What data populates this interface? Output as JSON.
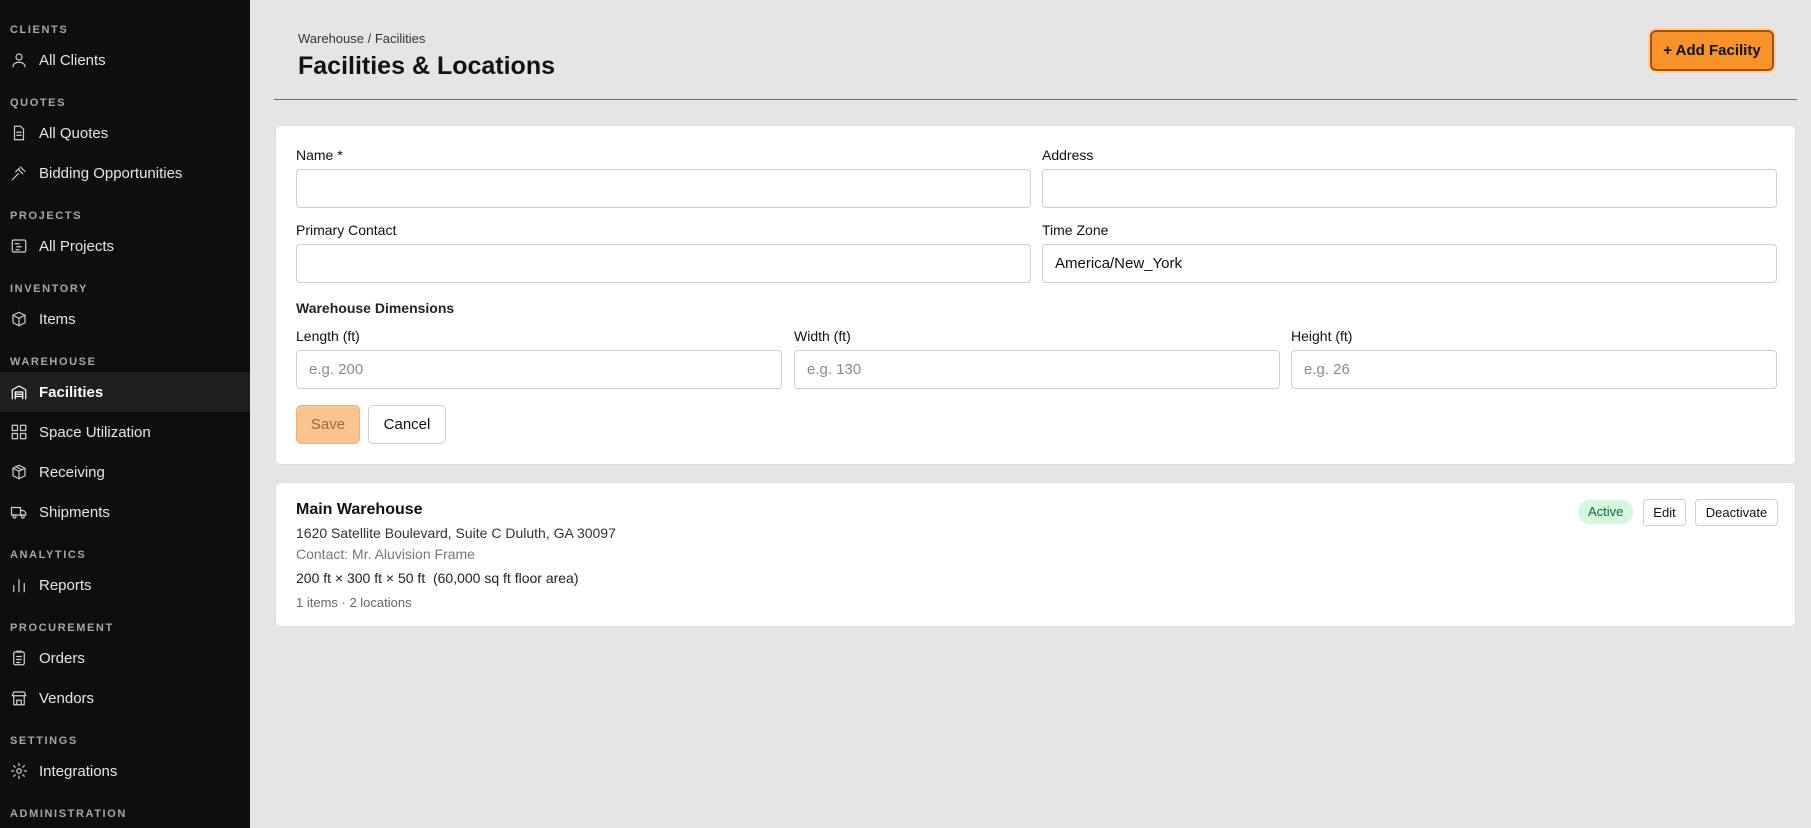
{
  "sidebar": {
    "sections": {
      "clients": "CLIENTS",
      "quotes": "QUOTES",
      "projects": "PROJECTS",
      "inventory": "INVENTORY",
      "warehouse": "WAREHOUSE",
      "analytics": "ANALYTICS",
      "procurement": "PROCUREMENT",
      "settings": "SETTINGS",
      "administration": "ADMINISTRATION"
    },
    "items": {
      "all_clients": "All Clients",
      "all_quotes": "All Quotes",
      "bidding": "Bidding Opportunities",
      "all_projects": "All Projects",
      "items": "Items",
      "facilities": "Facilities",
      "space_utilization": "Space Utilization",
      "receiving": "Receiving",
      "shipments": "Shipments",
      "reports": "Reports",
      "orders": "Orders",
      "vendors": "Vendors",
      "integrations": "Integrations"
    },
    "active_item": "facilities",
    "icons": {
      "all_clients": "user-icon",
      "all_quotes": "document-icon",
      "bidding": "gavel-icon",
      "all_projects": "gantt-icon",
      "items": "box-icon",
      "facilities": "warehouse-icon",
      "space_utilization": "grid-icon",
      "receiving": "package-icon",
      "shipments": "truck-icon",
      "reports": "bar-chart-icon",
      "orders": "clipboard-icon",
      "vendors": "store-icon",
      "integrations": "gear-icon"
    }
  },
  "header": {
    "breadcrumb": "Warehouse / Facilities",
    "title": "Facilities & Locations",
    "add_button": "+ Add Facility"
  },
  "form": {
    "name_label": "Name *",
    "name_value": "",
    "address_label": "Address",
    "address_value": "",
    "contact_label": "Primary Contact",
    "contact_value": "",
    "timezone_label": "Time Zone",
    "timezone_value": "America/New_York",
    "dimensions_heading": "Warehouse Dimensions",
    "length_label": "Length (ft)",
    "length_placeholder": "e.g. 200",
    "width_label": "Width (ft)",
    "width_placeholder": "e.g. 130",
    "height_label": "Height (ft)",
    "height_placeholder": "e.g. 26",
    "save_label": "Save",
    "cancel_label": "Cancel"
  },
  "facility": {
    "name": "Main Warehouse",
    "address": "1620 Satellite Boulevard, Suite C Duluth, GA 30097",
    "contact": "Contact: Mr. Aluvision Frame",
    "dimensions": "200 ft × 300 ft × 50 ft  (60,000 sq ft floor area)",
    "meta": "1 items · 2 locations",
    "status": "Active",
    "edit_label": "Edit",
    "deactivate_label": "Deactivate"
  },
  "colors": {
    "accent": "#f7932a",
    "sidebar_bg": "#0e0e0e",
    "page_bg": "#e5e5e5",
    "active_badge_bg": "#d5f6df",
    "active_badge_text": "#116a3a"
  }
}
